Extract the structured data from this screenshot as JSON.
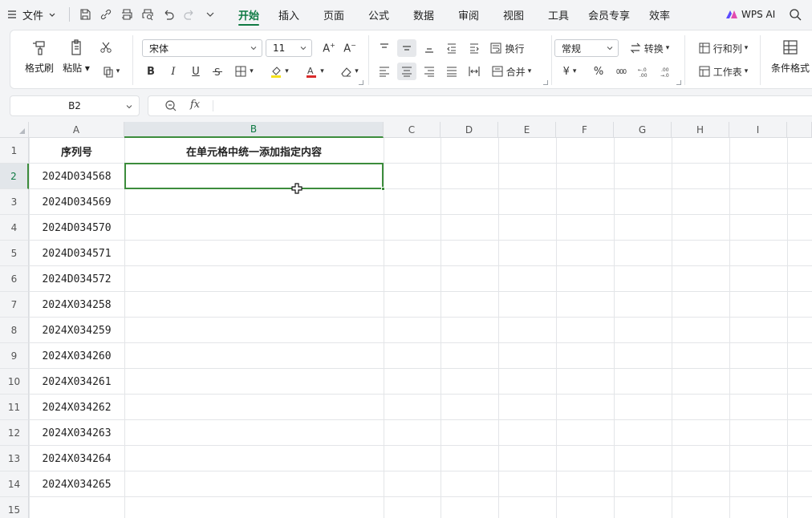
{
  "menu": {
    "file_label": "文件",
    "tabs": [
      "开始",
      "插入",
      "页面",
      "公式",
      "数据",
      "审阅",
      "视图",
      "工具",
      "会员专享",
      "效率"
    ],
    "active_tab": 0,
    "wps_ai": "WPS AI"
  },
  "ribbon": {
    "format_painter": "格式刷",
    "paste": "粘贴",
    "font_name": "宋体",
    "font_size": "11",
    "bold": "B",
    "italic": "I",
    "underline": "U",
    "wrap": "换行",
    "merge": "合并",
    "number_format": "常规",
    "convert": "转换",
    "rows_cols": "行和列",
    "worksheet": "工作表",
    "cond_format": "条件格式",
    "currency_symbol": "¥",
    "percent_symbol": "%",
    "thousands_symbol": "000",
    "font_color_accent": "#d92b2b",
    "fill_color_accent": "#f5e21b"
  },
  "formula_bar": {
    "cell_ref": "B2",
    "fx_label": "fx",
    "formula": ""
  },
  "sheet": {
    "columns": [
      "A",
      "B",
      "C",
      "D",
      "E",
      "F",
      "G",
      "H",
      "I"
    ],
    "rows": [
      "1",
      "2",
      "3",
      "4",
      "5",
      "6",
      "7",
      "8",
      "9",
      "10",
      "11",
      "12",
      "13",
      "14",
      "15"
    ],
    "selected_cell": "B2",
    "header_a": "序列号",
    "header_b": "在单元格中统一添加指定内容",
    "col_a_values": [
      "2024D034568",
      "2024D034569",
      "2024D034570",
      "2024D034571",
      "2024D034572",
      "2024X034258",
      "2024X034259",
      "2024X034260",
      "2024X034261",
      "2024X034262",
      "2024X034263",
      "2024X034264",
      "2024X034265"
    ],
    "accent_color": "#3c8c3c"
  }
}
